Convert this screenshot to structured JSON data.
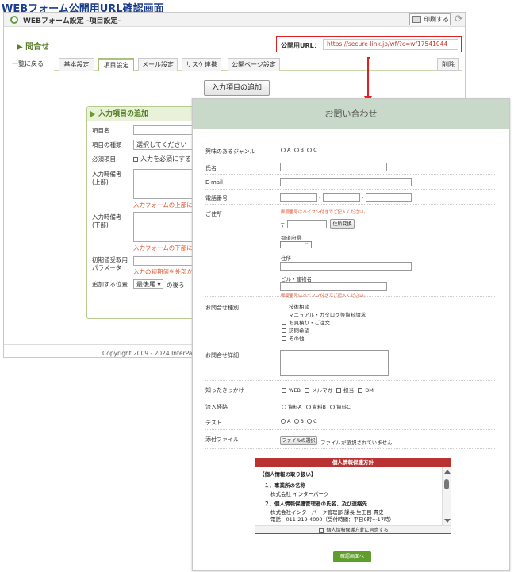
{
  "heading": "WEBフォーム公開用URL確認画面",
  "admin": {
    "title": "WEBフォーム設定 -項目設定-",
    "print_label": "印刷する",
    "section_title": "▶ 問合せ",
    "url_label": "公開用URL：",
    "url_value": "https://secure-link.jp/wf/?c=wf17541044",
    "back_link": "一覧に戻る",
    "tabs": [
      "基本設定",
      "項目設定",
      "メール設定",
      "サスケ連携",
      "公開ページ設定"
    ],
    "delete_label": "削除",
    "add_button": "入力項目の追加",
    "panel": {
      "title": "入力項目の追加",
      "labels": {
        "name": "項目名",
        "type": "項目の種類",
        "required": "必須項目",
        "upper_note": "入力時備考\n(上部)",
        "lower_note": "入力時備考\n(下部)",
        "initial": "初期値受取用\nパラメータ",
        "position": "追加する位置"
      },
      "type_value": "選択してください",
      "required_checkbox": "入力を必須にする",
      "upper_hint": "入力フォームの上部に",
      "lower_hint": "入力フォームの下部に",
      "initial_hint": "入力の初期値を外部か",
      "position_value": "最後尾",
      "position_suffix": "の後ろ"
    },
    "copyright": "Copyright 2009 - 2024 InterPa"
  },
  "form": {
    "title": "お問い合わせ",
    "fields": {
      "genre": "興味のあるジャンル",
      "name": "氏名",
      "email": "E-mail",
      "phone": "電話番号",
      "address": "ご住所",
      "inquiry_type": "お問合せ種別",
      "inquiry_detail": "お問合せ詳細",
      "source": "知ったきっかけ",
      "route": "流入経路",
      "test": "テスト",
      "attachment": "添付ファイル"
    },
    "genre_options": [
      "A",
      "B",
      "C"
    ],
    "phone_sep": "-",
    "hyphen_note": "郵便番号はハイフン付きでご記入ください。",
    "postal_mark": "〒",
    "address_button": "住所変換",
    "prefecture_label": "都道府県",
    "address_label": "住所",
    "building_label": "ビル・建物名",
    "hyphen_note2": "郵便番号はハイフン付きでご記入ください。",
    "inquiry_options": [
      "技術相談",
      "マニュアル・カタログ等資料請求",
      "お見積り・ご注文",
      "訪問希望",
      "その他"
    ],
    "source_options": [
      "WEB",
      "メルマガ",
      "担当",
      "DM"
    ],
    "route_options": [
      "資料A",
      "資料B",
      "資料C"
    ],
    "test_options": [
      "A",
      "B",
      "C"
    ],
    "file_button": "ファイルの選択",
    "file_status": "ファイルが選択されていません",
    "privacy": {
      "title": "個人情報保護方針",
      "lines": [
        "【個人情報の取り扱い】",
        "１．事業所の名称",
        "株式会社 インターパーク",
        "２．個人情報保護管理者の氏名、及び連絡先",
        "株式会社インターパーク管理部 課長 生田目 貴史",
        "電話：011-219-4000（受付時間：平日9時〜17時）"
      ],
      "agree_label": "個人情報保護方針に同意する"
    },
    "confirm_button": "確認画面へ"
  }
}
